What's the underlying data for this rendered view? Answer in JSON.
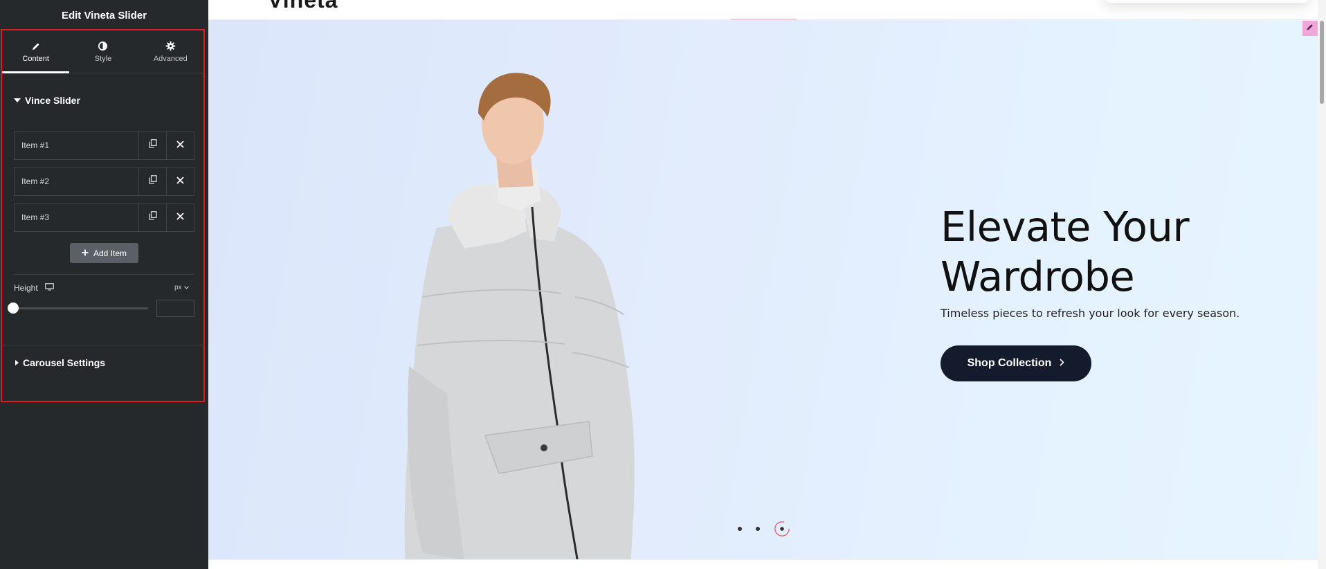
{
  "sidebar": {
    "title": "Edit Vineta Slider",
    "tabs": [
      {
        "label": "Content",
        "icon": "pencil-icon",
        "active": true
      },
      {
        "label": "Style",
        "icon": "contrast-icon",
        "active": false
      },
      {
        "label": "Advanced",
        "icon": "gear-icon",
        "active": false
      }
    ],
    "section_slider": "Vince Slider",
    "items": [
      {
        "label": "Item #1"
      },
      {
        "label": "Item #2"
      },
      {
        "label": "Item #3"
      }
    ],
    "add_item_label": "Add Item",
    "height_label": "Height",
    "height_unit": "px",
    "height_value": "",
    "section_carousel": "Carousel Settings",
    "highlight_color": "#e01b24"
  },
  "preview": {
    "logo_fragment": "Vineta",
    "headline_line1": "Elevate Your",
    "headline_line2": "Wardrobe",
    "subline": "Timeless pieces to refresh your look for every season.",
    "cta_label": "Shop Collection",
    "dots_count": 3,
    "active_dot": 3,
    "accent_color": "#131b2c"
  }
}
